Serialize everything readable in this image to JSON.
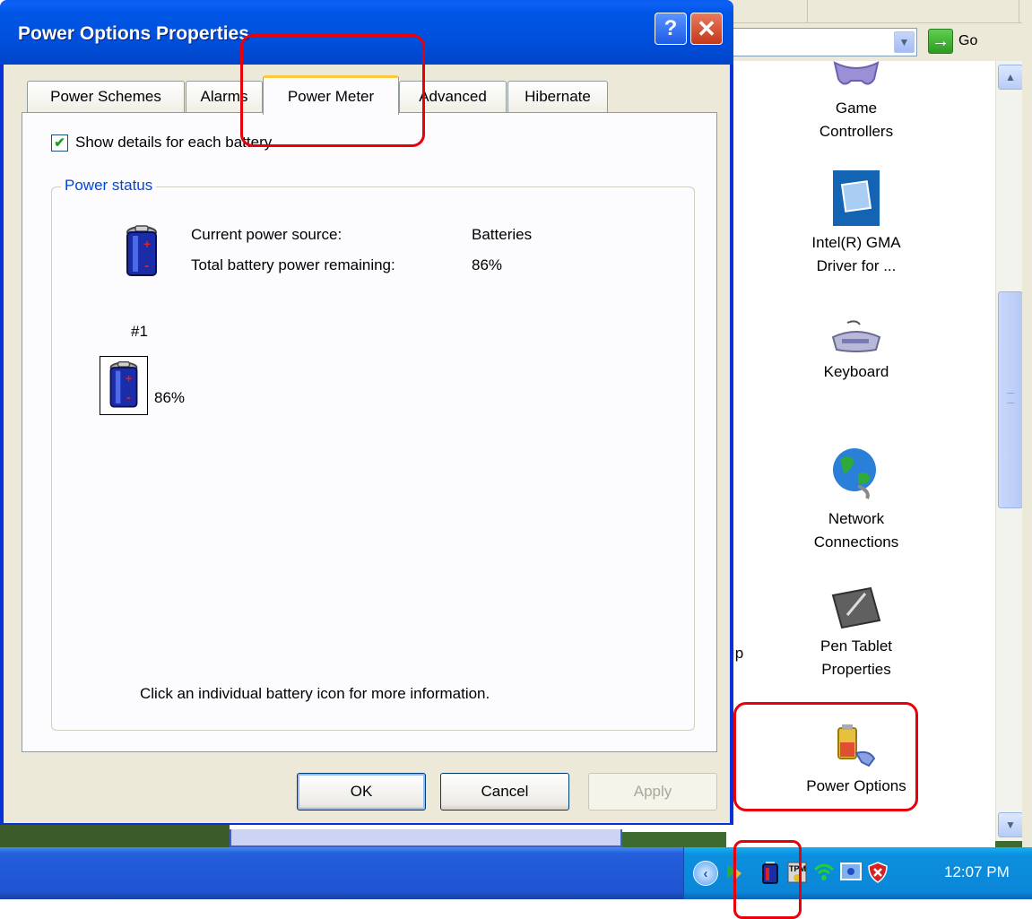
{
  "dialog": {
    "title": "Power Options Properties",
    "help_glyph": "?",
    "close_glyph": "✕",
    "tabs": [
      {
        "label": "Power Schemes",
        "active": false
      },
      {
        "label": "Alarms",
        "active": false
      },
      {
        "label": "Power Meter",
        "active": true
      },
      {
        "label": "Advanced",
        "active": false
      },
      {
        "label": "Hibernate",
        "active": false
      }
    ],
    "show_details": {
      "label": "Show details for each battery.",
      "checked": true
    },
    "power_status": {
      "group_label": "Power status",
      "current_source_label": "Current power source:",
      "current_source_value": "Batteries",
      "remaining_label": "Total battery power remaining:",
      "remaining_value": "86%",
      "battery_index_label": "#1",
      "battery_percent": "86%",
      "hint": "Click an individual battery icon for more information."
    },
    "buttons": {
      "ok": "OK",
      "cancel": "Cancel",
      "apply": "Apply"
    }
  },
  "explorer": {
    "go_label": "Go",
    "items": [
      {
        "label_line1": "Game",
        "label_line2": "Controllers",
        "icon": "game-controller-icon"
      },
      {
        "label_line1": "Intel(R) GMA",
        "label_line2": "Driver for ...",
        "icon": "intel-gma-icon"
      },
      {
        "label_line1": "Keyboard",
        "label_line2": "",
        "icon": "keyboard-icon"
      },
      {
        "label_line1": "Network",
        "label_line2": "Connections",
        "icon": "network-globe-icon"
      },
      {
        "label_line1": "Pen Tablet",
        "label_line2": "Properties",
        "icon": "pen-tablet-icon"
      },
      {
        "label_line1": "Power Options",
        "label_line2": "",
        "icon": "power-options-icon"
      }
    ],
    "partial_label": "ıp"
  },
  "taskbar": {
    "clock": "12:07 PM",
    "tray_icons": [
      "show-hidden-icon",
      "network-activity-icon",
      "battery-icon",
      "tpm-icon",
      "wireless-icon",
      "display-icon",
      "security-shield-icon"
    ]
  },
  "colors": {
    "title_blue": "#0055e5",
    "taskbar_blue": "#245edb",
    "tray_blue": "#0b86d8",
    "annotation_red": "#e8000b",
    "active_tab_accent": "#ffc83c",
    "group_label_blue": "#0046d5"
  }
}
